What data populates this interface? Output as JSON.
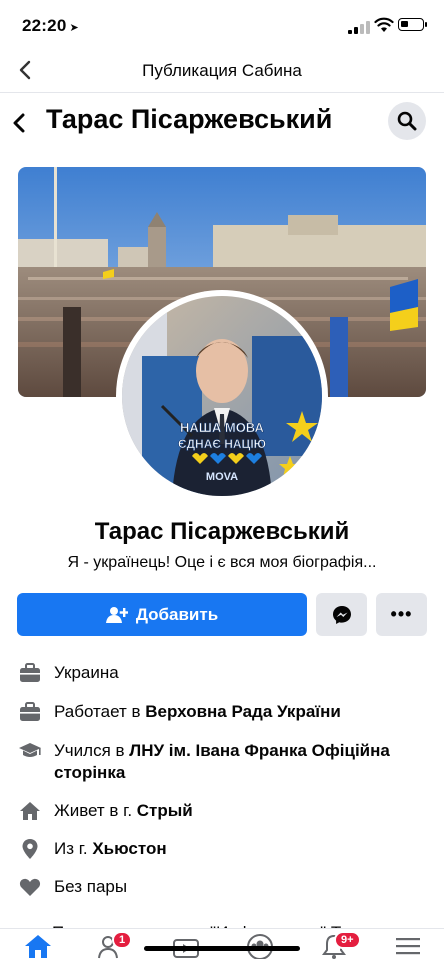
{
  "status": {
    "time": "22:20"
  },
  "nav": {
    "title": "Публикация Сабина"
  },
  "profile": {
    "header_name": "Тарас Пісаржевський",
    "name": "Тарас Пісаржевський",
    "bio": "Я - українець! Оце і є вся моя біографія...",
    "avatar_caption_line1": "НАША МОВА",
    "avatar_caption_line2": "ЄДНАЄ НАЦІЮ",
    "avatar_caption_line3": "MOVA"
  },
  "actions": {
    "add_label": "Добавить"
  },
  "intro": [
    {
      "icon": "briefcase-icon",
      "plain": "Украина",
      "bold": ""
    },
    {
      "icon": "briefcase-icon",
      "plain": "Работает в ",
      "bold": "Верховна Рада України"
    },
    {
      "icon": "graduation-cap-icon",
      "plain": "Учился в ",
      "bold": "ЛНУ ім. Івана Франка Офіційна сторінка"
    },
    {
      "icon": "home-icon",
      "plain": "Живет в г. ",
      "bold": "Стрый"
    },
    {
      "icon": "location-pin-icon",
      "plain": "Из г. ",
      "bold": "Хьюстон"
    },
    {
      "icon": "heart-icon",
      "plain": "Без пары",
      "bold": ""
    }
  ],
  "cut_text": "Посмотреть раздел \"Информация\" Тарас",
  "tabs": {
    "friends_badge": "1",
    "notifications_badge": "9+"
  },
  "colors": {
    "accent": "#1877f2",
    "badge": "#e41e3f",
    "button_bg": "#e4e6eb"
  }
}
